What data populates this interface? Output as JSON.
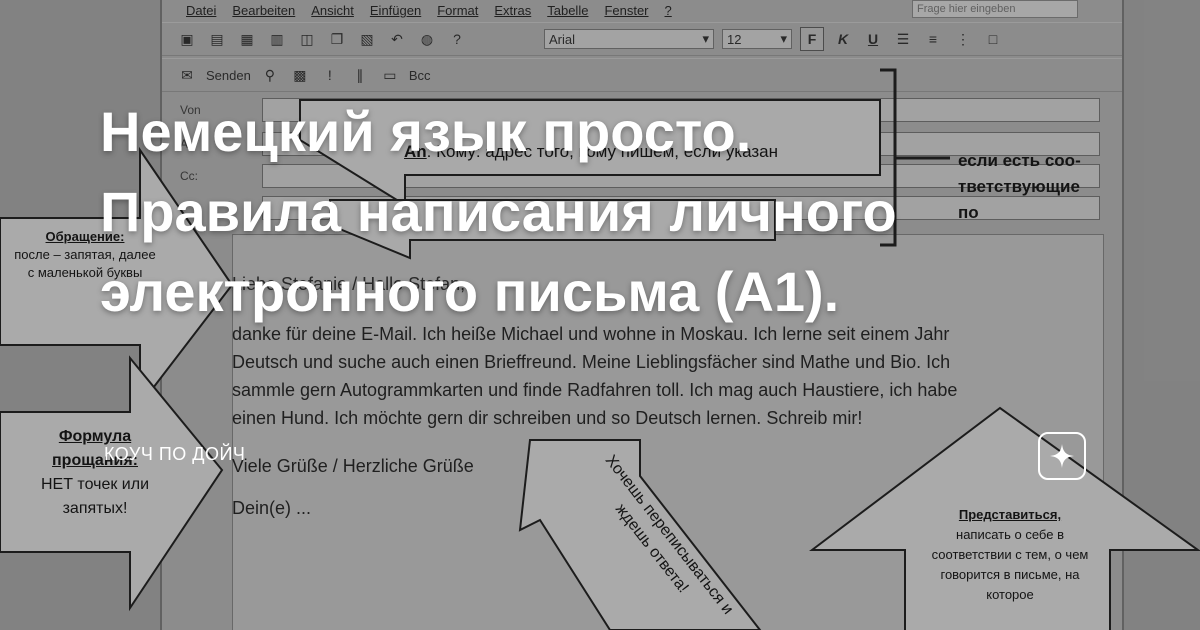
{
  "menu": [
    "Datei",
    "Bearbeiten",
    "Ansicht",
    "Einfügen",
    "Format",
    "Extras",
    "Tabelle",
    "Fenster",
    "?"
  ],
  "help_placeholder": "Frage hier eingeben",
  "toolbar": {
    "font": "Arial",
    "size": "12",
    "bold": "F",
    "italic": "K",
    "underline": "U",
    "send": "Senden",
    "bcc": "Bcc"
  },
  "fields": {
    "from_label": "Von",
    "to_label": "An",
    "cc_label": "Cc:",
    "to_hint_label": "An",
    "to_hint_text": ": Кому: адрес того, кому пишем, если указан",
    "right_note": "если есть соо- тветствующие по"
  },
  "letter": {
    "greeting": "Liebe Stefanie / Hallo Stefan,",
    "body": [
      "danke für deine E-Mail. Ich heiße Michael und wohne in Moskau. Ich lerne seit einem Jahr",
      "Deutsch und suche auch einen Brieffreund. Meine Lieblingsfächer sind Mathe und Bio.  Ich",
      "sammle gern Autogrammkarten und finde Radfahren toll. Ich mag auch Haustiere, ich habe",
      "einen Hund. Ich möchte gern dir schreiben und so Deutsch lernen. Schreib mir!"
    ],
    "closing": "Viele Grüße / Herzliche Grüße",
    "signature": "Dein(e) ..."
  },
  "annotations": {
    "address_title": "Обращение:",
    "address_text": "после – запятая, далее с маленькой буквы",
    "farewell_title": "Формула прощания:",
    "farewell_text": "НЕТ точек или запятых!",
    "reply_text": "Хочешь переписываться и ждешь ответа!",
    "intro_title": "Представиться,",
    "intro_text": "написать о себе в соответствии с тем, о чем говорится в письме, на которое"
  },
  "overlay": {
    "title_lines": [
      "Немецкий язык просто.",
      "Правила написания личного",
      "электронного письма (А1)."
    ],
    "channel": "КОУЧ ПО ДОЙЧ"
  },
  "badge_icon": "sparkle-icon"
}
